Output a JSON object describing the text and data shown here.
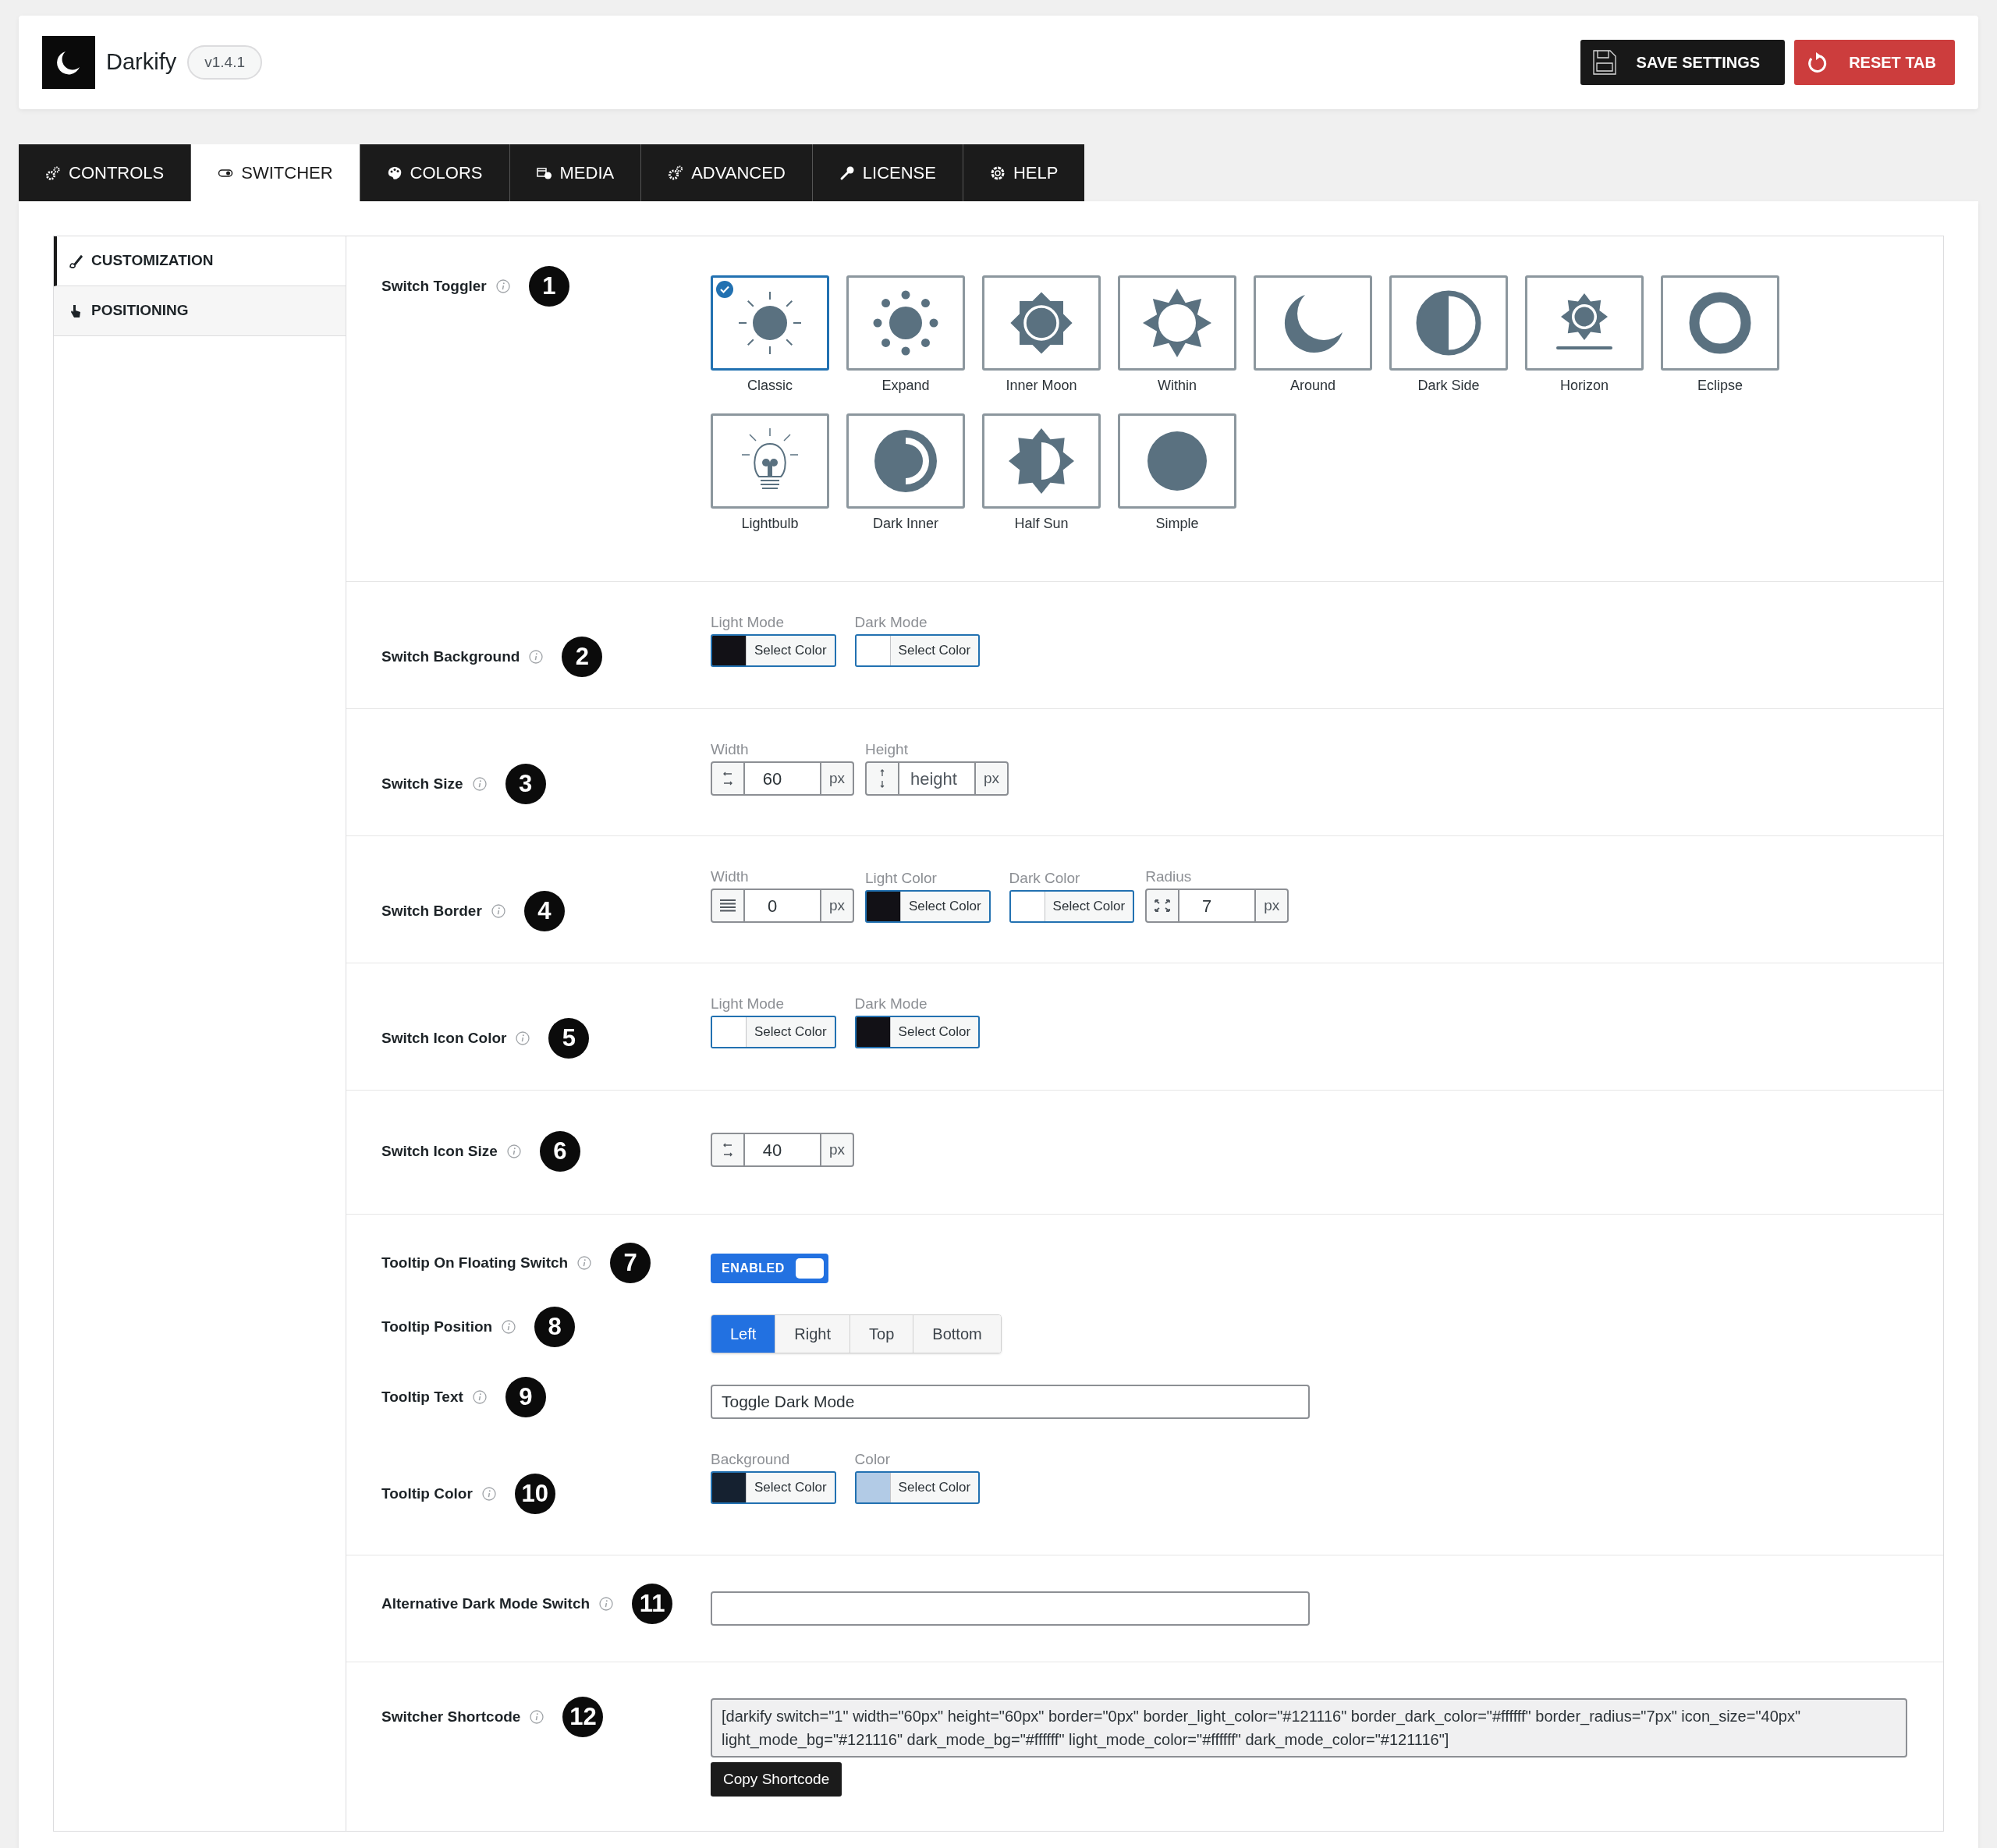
{
  "header": {
    "app_name": "Darkify",
    "version": "v1.4.1",
    "buttons": [
      {
        "label": "SAVE SETTINGS",
        "kind": "save"
      },
      {
        "label": "RESET TAB",
        "kind": "reset"
      }
    ]
  },
  "tabs": [
    {
      "label": "CONTROLS",
      "selected": false
    },
    {
      "label": "SWITCHER",
      "selected": true
    },
    {
      "label": "COLORS",
      "selected": false
    },
    {
      "label": "MEDIA",
      "selected": false
    },
    {
      "label": "ADVANCED",
      "selected": false
    },
    {
      "label": "LICENSE",
      "selected": false
    },
    {
      "label": "HELP",
      "selected": false
    }
  ],
  "sidebar": {
    "items": [
      {
        "label": "CUSTOMIZATION",
        "selected": true
      },
      {
        "label": "POSITIONING",
        "selected": false
      }
    ]
  },
  "sections": [
    {
      "rows": [
        {
          "kind": "toggler",
          "label": "Switch Toggler",
          "number": "1",
          "options": [
            {
              "label": "Classic",
              "selected": true
            },
            {
              "label": "Expand",
              "selected": false
            },
            {
              "label": "Inner Moon",
              "selected": false
            },
            {
              "label": "Within",
              "selected": false
            },
            {
              "label": "Around",
              "selected": false
            },
            {
              "label": "Dark Side",
              "selected": false
            },
            {
              "label": "Horizon",
              "selected": false
            },
            {
              "label": "Eclipse",
              "selected": false
            },
            {
              "label": "Lightbulb",
              "selected": false
            },
            {
              "label": "Dark Inner",
              "selected": false
            },
            {
              "label": "Half Sun",
              "selected": false
            },
            {
              "label": "Simple",
              "selected": false
            }
          ]
        }
      ]
    },
    {
      "rows": [
        {
          "kind": "fields",
          "label": "Switch Background",
          "number": "2",
          "fields": [
            {
              "kind": "color",
              "label": "Light Mode",
              "button": "Select Color",
              "color": "#121116"
            },
            {
              "kind": "color",
              "label": "Dark Mode",
              "button": "Select Color",
              "color": "#ffffff"
            }
          ]
        }
      ]
    },
    {
      "rows": [
        {
          "kind": "fields",
          "label": "Switch Size",
          "number": "3",
          "fields": [
            {
              "kind": "width",
              "label": "Width",
              "value": "60",
              "unit": "px"
            },
            {
              "kind": "height",
              "label": "Height",
              "placeholder": "height",
              "unit": "px"
            }
          ]
        }
      ]
    },
    {
      "rows": [
        {
          "kind": "fields",
          "label": "Switch Border",
          "number": "4",
          "fields": [
            {
              "kind": "border",
              "label": "Width",
              "value": "0",
              "unit": "px"
            },
            {
              "kind": "color",
              "label": "Light Color",
              "button": "Select Color",
              "color": "#121116"
            },
            {
              "kind": "color",
              "label": "Dark Color",
              "button": "Select Color",
              "color": "#ffffff"
            },
            {
              "kind": "radius",
              "label": "Radius",
              "value": "7",
              "unit": "px"
            }
          ]
        }
      ]
    },
    {
      "rows": [
        {
          "kind": "fields",
          "label": "Switch Icon Color",
          "number": "5",
          "fields": [
            {
              "kind": "color",
              "label": "Light Mode",
              "button": "Select Color",
              "color": "#ffffff"
            },
            {
              "kind": "color",
              "label": "Dark Mode",
              "button": "Select Color",
              "color": "#121116"
            }
          ]
        }
      ]
    },
    {
      "rows": [
        {
          "kind": "fields",
          "label": "Switch Icon Size",
          "number": "6",
          "fields": [
            {
              "kind": "width",
              "value": "40",
              "unit": "px"
            }
          ]
        }
      ]
    },
    {
      "rows": [
        {
          "kind": "toggle",
          "label": "Tooltip On Floating Switch",
          "number": "7",
          "on": true,
          "text": "ENABLED"
        },
        {
          "kind": "segmented",
          "label": "Tooltip Position",
          "number": "8",
          "options": [
            {
              "label": "Left",
              "selected": true
            },
            {
              "label": "Right",
              "selected": false
            },
            {
              "label": "Top",
              "selected": false
            },
            {
              "label": "Bottom",
              "selected": false
            }
          ]
        },
        {
          "kind": "text",
          "label": "Tooltip Text",
          "number": "9",
          "value": "Toggle Dark Mode"
        },
        {
          "kind": "fields",
          "label": "Tooltip Color",
          "number": "10",
          "fields": [
            {
              "kind": "color",
              "label": "Background",
              "button": "Select Color",
              "color": "#152130"
            },
            {
              "kind": "color",
              "label": "Color",
              "button": "Select Color",
              "color": "#b2cbe6"
            }
          ]
        }
      ]
    },
    {
      "rows": [
        {
          "kind": "text",
          "label": "Alternative Dark Mode Switch",
          "number": "11"
        }
      ]
    },
    {
      "rows": [
        {
          "kind": "shortcode",
          "label": "Switcher Shortcode",
          "number": "12",
          "value": "[darkify switch=\"1\" width=\"60px\" height=\"60px\" border=\"0px\" border_light_color=\"#121116\" border_dark_color=\"#ffffff\" border_radius=\"7px\" icon_size=\"40px\" light_mode_bg=\"#121116\" dark_mode_bg=\"#ffffff\" light_mode_color=\"#ffffff\" dark_mode_color=\"#121116\"]",
          "button": "Copy Shortcode"
        }
      ]
    }
  ]
}
